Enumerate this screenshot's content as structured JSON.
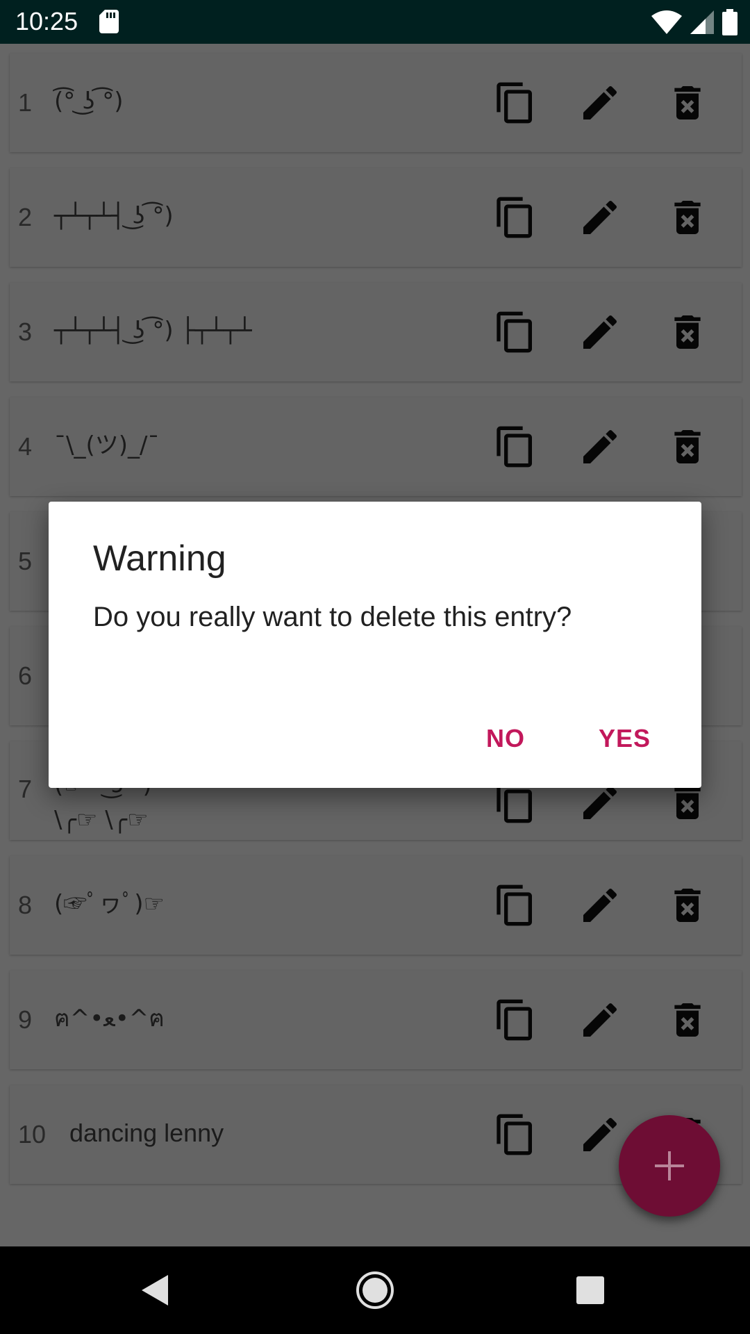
{
  "status_bar": {
    "time": "10:25"
  },
  "list": {
    "rows": [
      {
        "number": "1",
        "text": "(͡° ͜ʖ ͡°)"
      },
      {
        "number": "2",
        "text": "┬┴┬┴┤ ͜ʖ ͡°)"
      },
      {
        "number": "3",
        "text": "┬┴┬┴┤ ͜ʖ ͡°) ├┬┴┬┴"
      },
      {
        "number": "4",
        "text": "¯\\_(ツ)_/¯"
      },
      {
        "number": "5",
        "text": ""
      },
      {
        "number": "6",
        "text": ""
      },
      {
        "number": "7",
        "text": "(☞ ͡° ͜ʖ ͡°)\n\\╭☞ \\╭☞"
      },
      {
        "number": "8",
        "text": "(☞ﾟヮﾟ)☞"
      },
      {
        "number": "9",
        "text": "ฅ^•ﻌ•^ฅ"
      },
      {
        "number": "10",
        "text": "dancing lenny"
      }
    ]
  },
  "dialog": {
    "title": "Warning",
    "message": "Do you really want to delete this entry?",
    "no_label": "NO",
    "yes_label": "YES"
  },
  "colors": {
    "accent": "#c2185b",
    "fab": "#6e0d34",
    "status_bar": "#00201f"
  },
  "icons": {
    "copy": "copy-icon",
    "edit": "pencil-icon",
    "delete": "delete-icon",
    "add": "plus-icon"
  }
}
